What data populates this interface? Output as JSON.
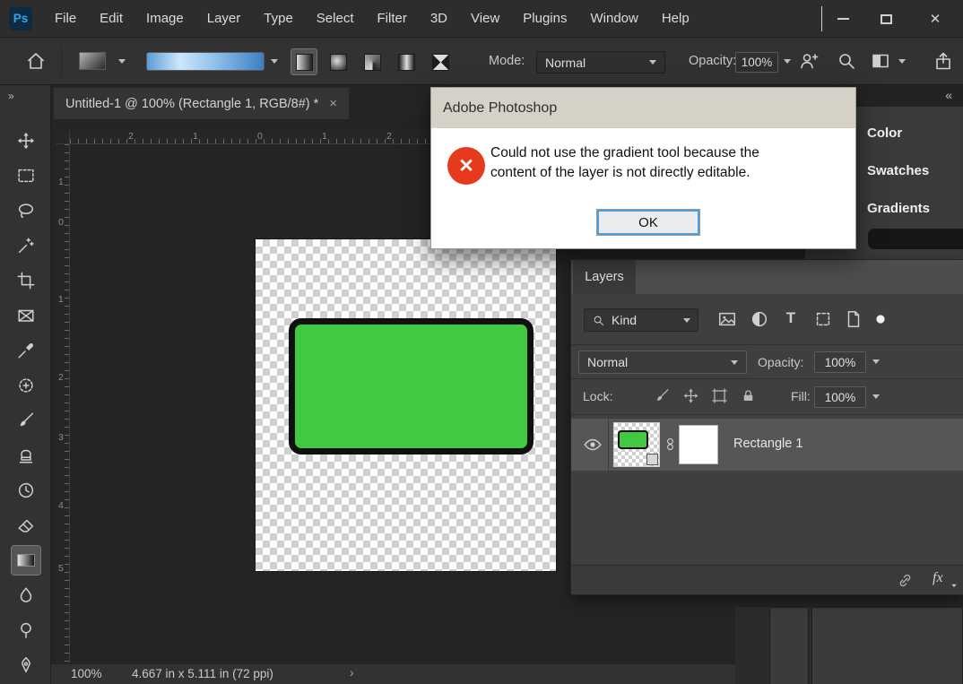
{
  "colors": {
    "accent_blue": "#37a3e8",
    "error_red": "#e63a1e",
    "shape_green": "#41c941",
    "ok_focus_border": "#4aa0df"
  },
  "menu_bar": {
    "logo": "Ps",
    "items": [
      "File",
      "Edit",
      "Image",
      "Layer",
      "Type",
      "Select",
      "Filter",
      "3D",
      "View",
      "Plugins",
      "Window",
      "Help"
    ]
  },
  "options_bar": {
    "mode_label": "Mode:",
    "mode_value": "Normal",
    "opacity_label": "Opacity:",
    "opacity_value": "100%"
  },
  "icons": {
    "close_window": "✕",
    "tab_close": "×",
    "collapse_right": "»",
    "collapse_left": "«",
    "status_chevron": "›",
    "type_filter": "T",
    "fx": "fx"
  },
  "document_tab": {
    "title": "Untitled-1 @ 100% (Rectangle 1, RGB/8#) *"
  },
  "rulers": {
    "horizontal": [
      "2",
      "1",
      "0",
      "1",
      "2"
    ],
    "vertical": [
      "1",
      "0",
      "1",
      "2",
      "3",
      "4",
      "5"
    ]
  },
  "dialog": {
    "title": "Adobe Photoshop",
    "message": "Could not use the gradient tool because the content of the layer is not directly editable.",
    "ok_label": "OK"
  },
  "right_dock": {
    "tabs": [
      "Color",
      "Swatches",
      "Gradients"
    ]
  },
  "layers_panel": {
    "tab_label": "Layers",
    "filter_label": "Kind",
    "blend_mode": "Normal",
    "opacity_label": "Opacity:",
    "opacity_value": "100%",
    "lock_label": "Lock:",
    "fill_label": "Fill:",
    "fill_value": "100%",
    "layers": [
      {
        "name": "Rectangle 1"
      }
    ]
  },
  "status_bar": {
    "zoom": "100%",
    "document_info": "4.667 in x 5.111 in (72 ppi)"
  }
}
